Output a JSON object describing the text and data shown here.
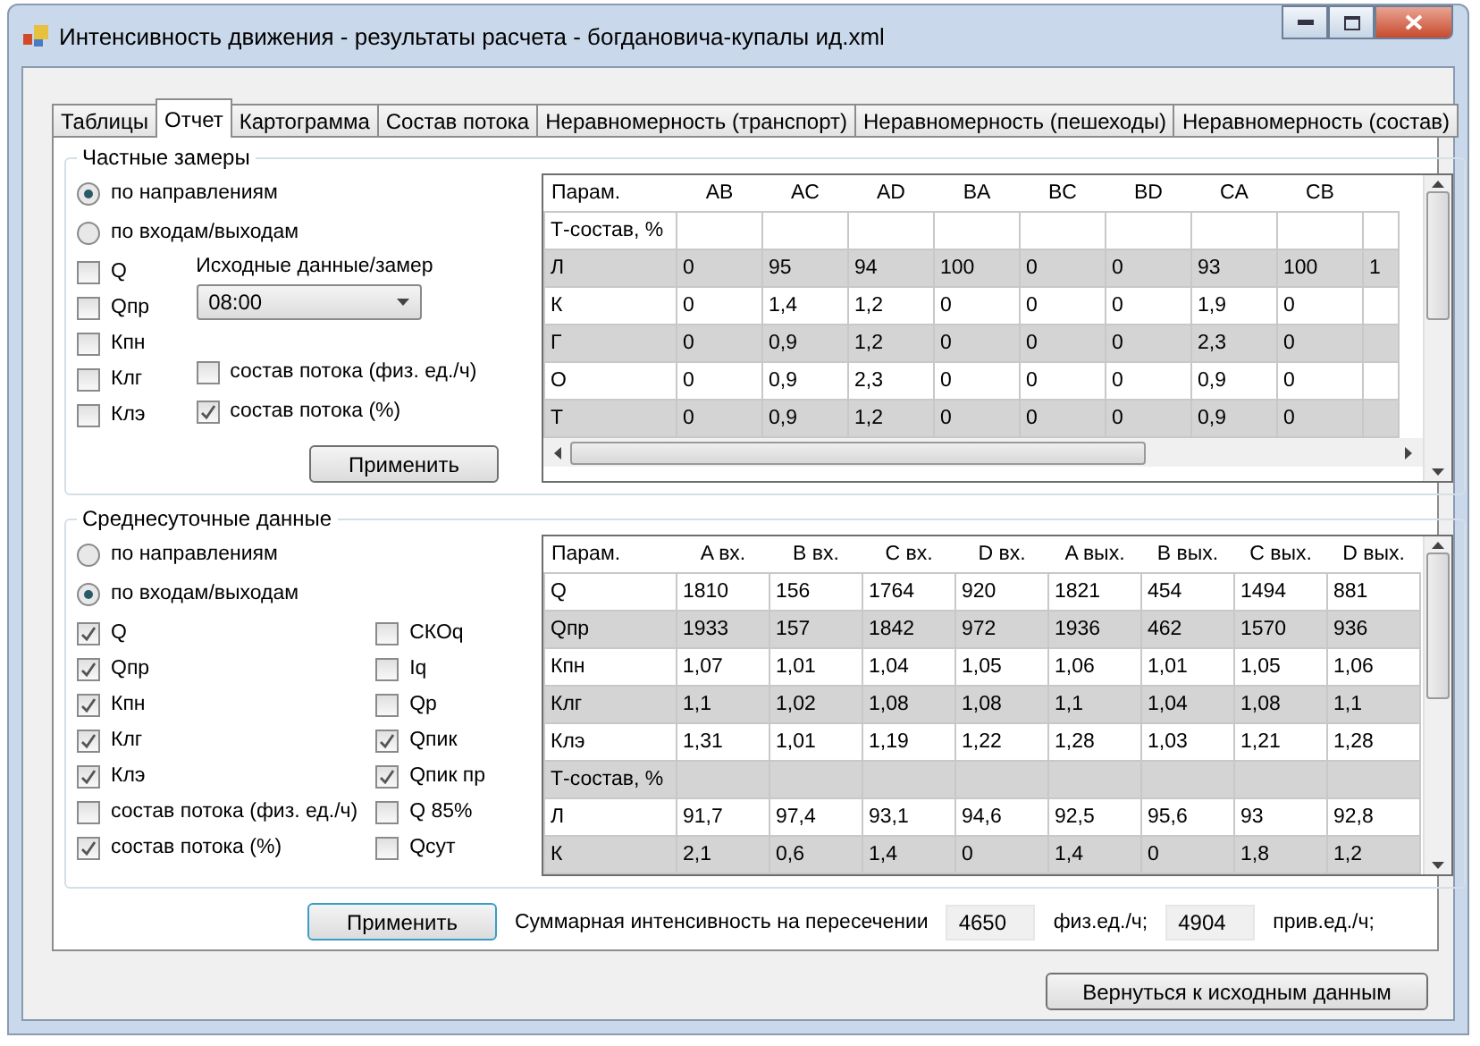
{
  "window": {
    "title": "Интенсивность движения - результаты расчета - богдановича-купалы ид.xml"
  },
  "tabs": [
    {
      "label": "Таблицы",
      "selected": false
    },
    {
      "label": "Отчет",
      "selected": true
    },
    {
      "label": "Картограмма",
      "selected": false
    },
    {
      "label": "Состав потока",
      "selected": false
    },
    {
      "label": "Неравномерность (транспорт)",
      "selected": false
    },
    {
      "label": "Неравномерность (пешеходы)",
      "selected": false
    },
    {
      "label": "Неравномерность (состав)",
      "selected": false
    }
  ],
  "partial": {
    "title": "Частные замеры",
    "radios": [
      {
        "label": "по направлениям",
        "selected": true
      },
      {
        "label": "по входам/выходам",
        "selected": false
      }
    ],
    "checkboxes": [
      {
        "label": "Q",
        "checked": false
      },
      {
        "label": "Qпр",
        "checked": false
      },
      {
        "label": "Кпн",
        "checked": false
      },
      {
        "label": "Клг",
        "checked": false
      },
      {
        "label": "Клэ",
        "checked": false
      }
    ],
    "source_label": "Исходные данные/замер",
    "source_value": "08:00",
    "composition_checkboxes": [
      {
        "label": "состав потока (физ. ед./ч)",
        "checked": false
      },
      {
        "label": "состав потока (%)",
        "checked": true
      }
    ],
    "apply_button": "Применить",
    "table": {
      "columns": [
        "Парам.",
        "AB",
        "AC",
        "AD",
        "BA",
        "BC",
        "BD",
        "CA",
        "CB"
      ],
      "rows": [
        [
          "Т-состав, %",
          "",
          "",
          "",
          "",
          "",
          "",
          "",
          ""
        ],
        [
          "Л",
          "0",
          "95",
          "94",
          "100",
          "0",
          "0",
          "93",
          "100",
          "1"
        ],
        [
          "К",
          "0",
          "1,4",
          "1,2",
          "0",
          "0",
          "0",
          "1,9",
          "0"
        ],
        [
          "Г",
          "0",
          "0,9",
          "1,2",
          "0",
          "0",
          "0",
          "2,3",
          "0"
        ],
        [
          "О",
          "0",
          "0,9",
          "2,3",
          "0",
          "0",
          "0",
          "0,9",
          "0"
        ],
        [
          "Т",
          "0",
          "0,9",
          "1,2",
          "0",
          "0",
          "0",
          "0,9",
          "0"
        ]
      ]
    }
  },
  "daily": {
    "title": "Среднесуточные данные",
    "radios": [
      {
        "label": "по направлениям",
        "selected": false
      },
      {
        "label": "по входам/выходам",
        "selected": true
      }
    ],
    "checkboxes_left": [
      {
        "label": "Q",
        "checked": true
      },
      {
        "label": "Qпр",
        "checked": true
      },
      {
        "label": "Кпн",
        "checked": true
      },
      {
        "label": "Клг",
        "checked": true
      },
      {
        "label": "Клэ",
        "checked": true
      },
      {
        "label": "состав потока (физ. ед./ч)",
        "checked": false
      },
      {
        "label": "состав потока (%)",
        "checked": true
      }
    ],
    "checkboxes_right": [
      {
        "label": "СКОq",
        "checked": false
      },
      {
        "label": "Iq",
        "checked": false
      },
      {
        "label": "Qр",
        "checked": false
      },
      {
        "label": "Qпик",
        "checked": true
      },
      {
        "label": "Qпик пр",
        "checked": true
      },
      {
        "label": "Q 85%",
        "checked": false
      },
      {
        "label": "Qсут",
        "checked": false
      }
    ],
    "apply_button": "Применить",
    "table": {
      "columns": [
        "Парам.",
        "A вх.",
        "B вх.",
        "C вх.",
        "D вх.",
        "A вых.",
        "B вых.",
        "C вых.",
        "D вых."
      ],
      "rows": [
        [
          "Q",
          "1810",
          "156",
          "1764",
          "920",
          "1821",
          "454",
          "1494",
          "881"
        ],
        [
          "Qпр",
          "1933",
          "157",
          "1842",
          "972",
          "1936",
          "462",
          "1570",
          "936"
        ],
        [
          "Кпн",
          "1,07",
          "1,01",
          "1,04",
          "1,05",
          "1,06",
          "1,01",
          "1,05",
          "1,06"
        ],
        [
          "Клг",
          "1,1",
          "1,02",
          "1,08",
          "1,08",
          "1,1",
          "1,04",
          "1,08",
          "1,1"
        ],
        [
          "Клэ",
          "1,31",
          "1,01",
          "1,19",
          "1,22",
          "1,28",
          "1,03",
          "1,21",
          "1,28"
        ],
        [
          "Т-состав, %",
          "",
          "",
          "",
          "",
          "",
          "",
          "",
          ""
        ],
        [
          "Л",
          "91,7",
          "97,4",
          "93,1",
          "94,6",
          "92,5",
          "95,6",
          "93",
          "92,8"
        ],
        [
          "К",
          "2,1",
          "0,6",
          "1,4",
          "0",
          "1,4",
          "0",
          "1,8",
          "1,2"
        ]
      ]
    },
    "total_label": "Суммарная интенсивность на пересечении",
    "total_phys": "4650",
    "phys_unit": "физ.ед./ч;",
    "total_given": "4904",
    "given_unit": "прив.ед./ч;"
  },
  "return_button": "Вернуться к исходным данным"
}
